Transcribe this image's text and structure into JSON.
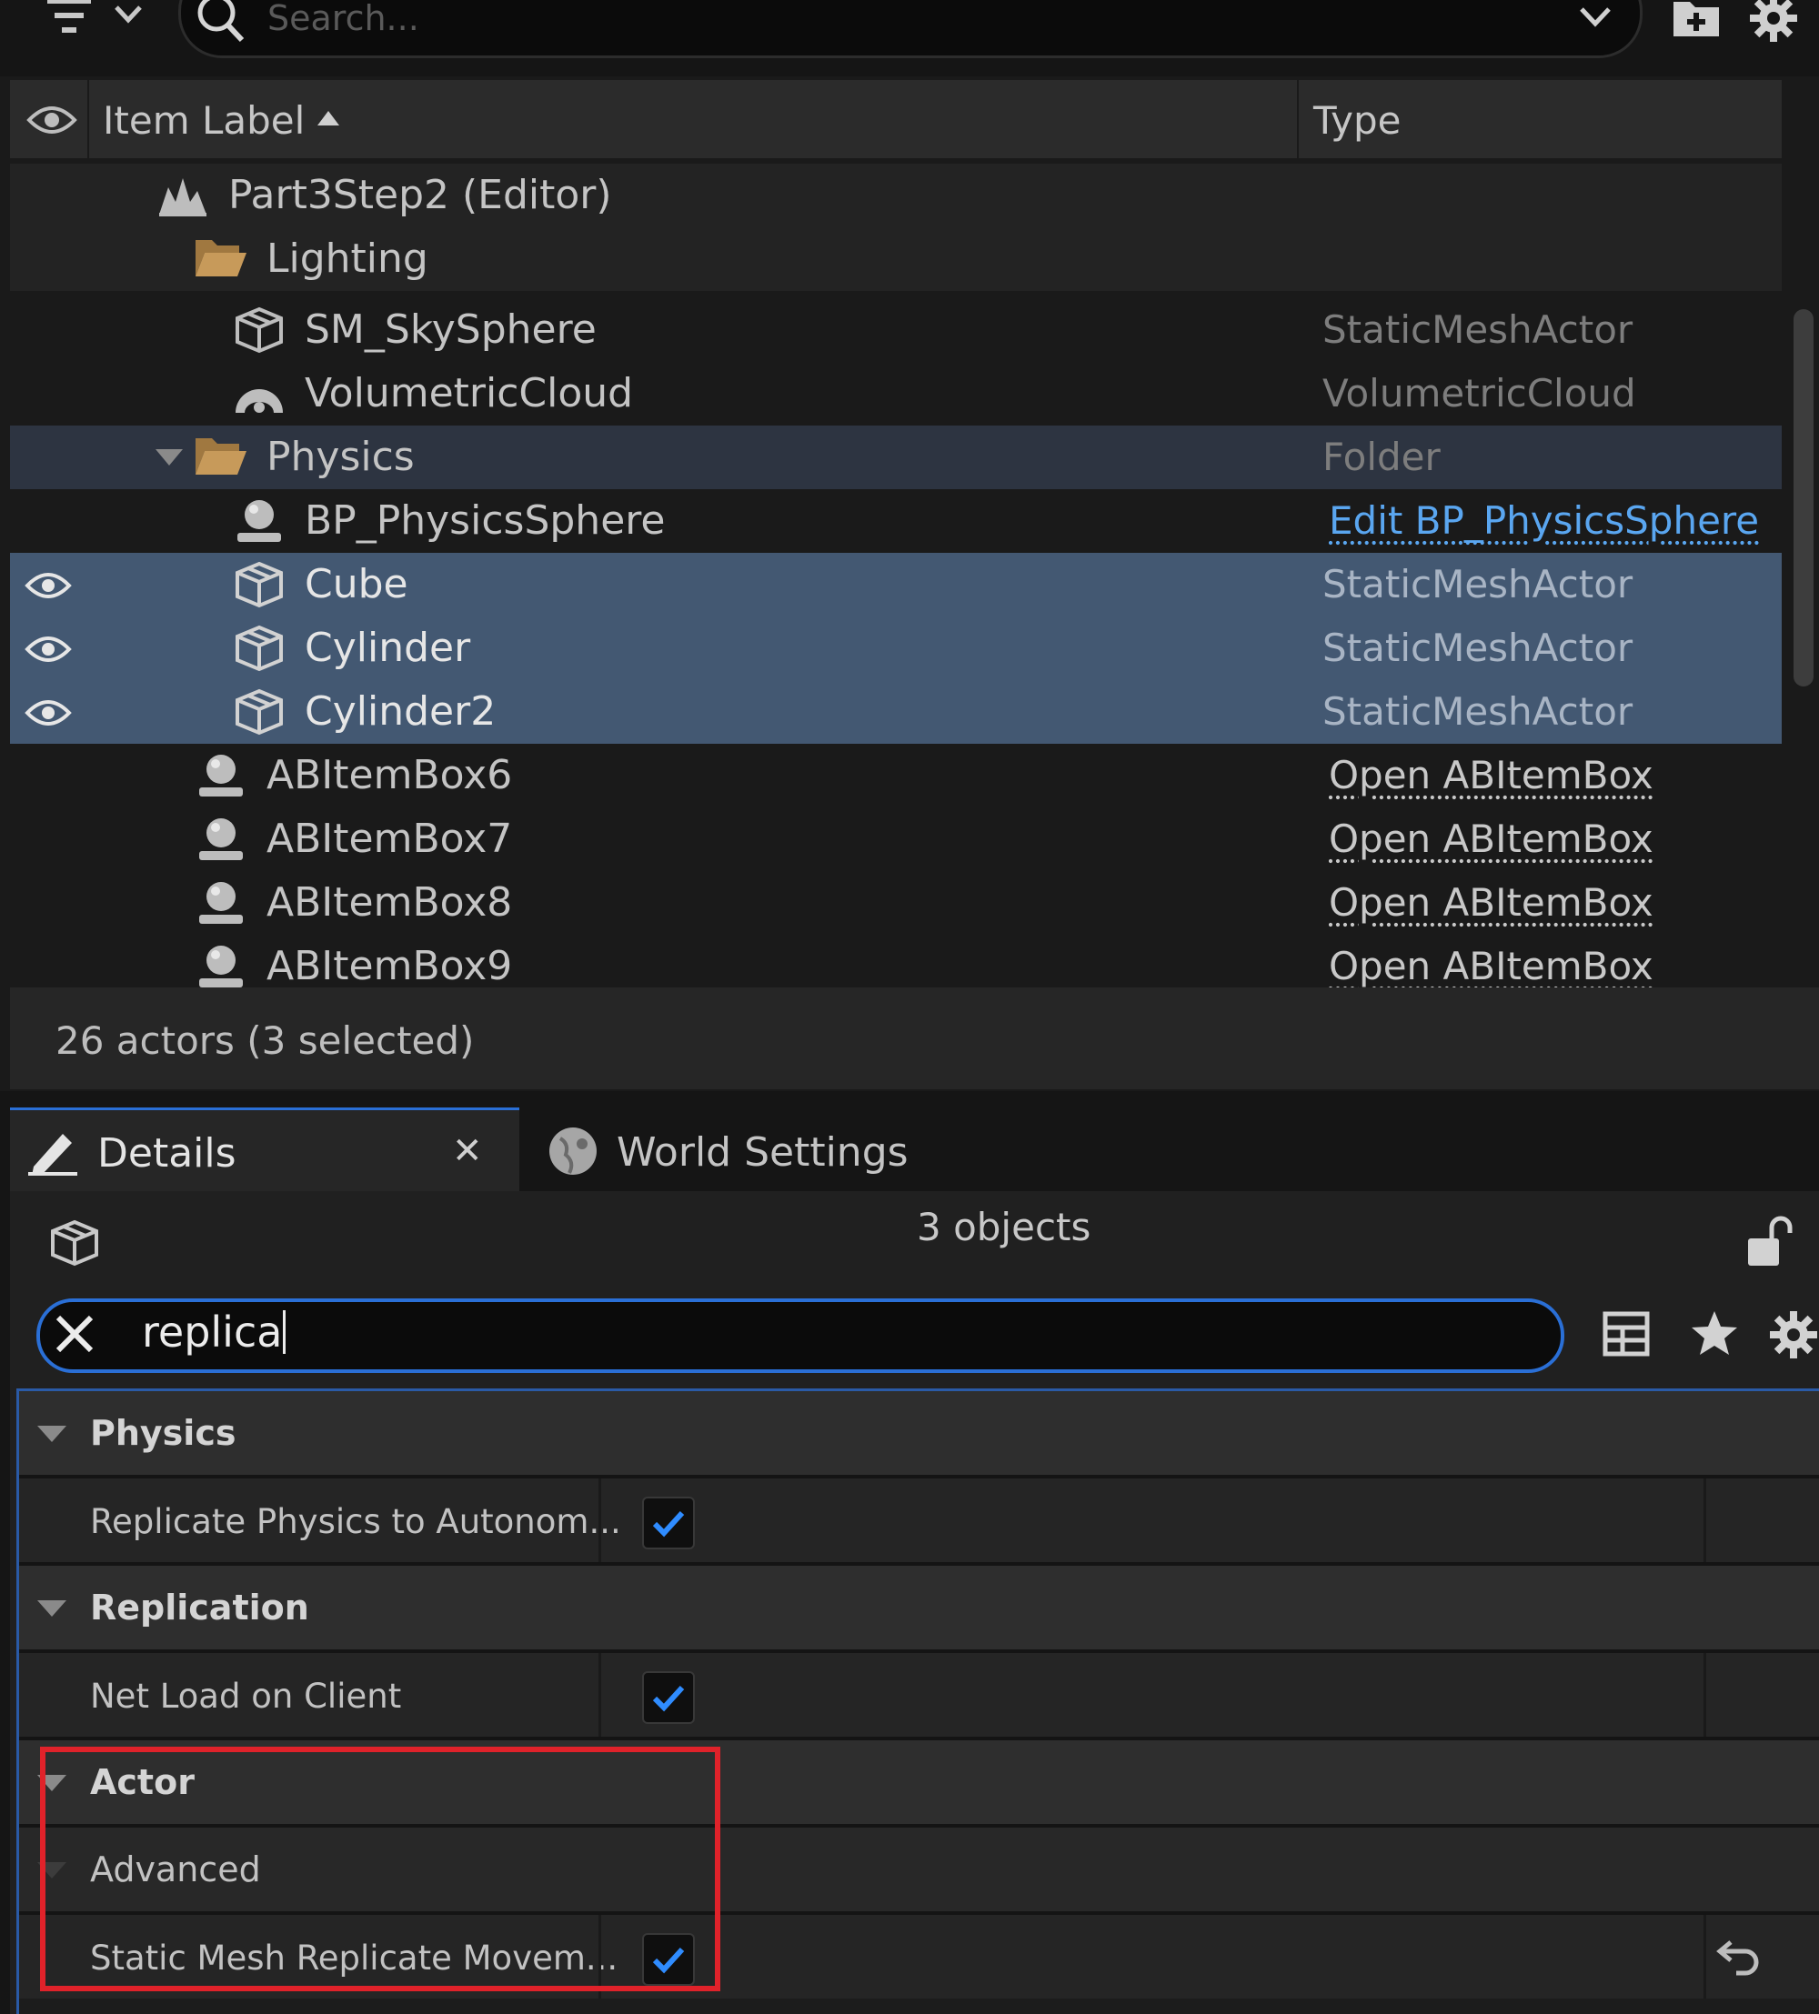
{
  "outliner": {
    "search_placeholder": "Search...",
    "columns": {
      "label": "Item Label",
      "type": "Type"
    },
    "rows": [
      {
        "label": "Part3Step2 (Editor)",
        "type": "",
        "icon": "level-icon"
      },
      {
        "label": "Lighting",
        "type": "",
        "icon": "folder-icon"
      },
      {
        "label": "SM_SkySphere",
        "type": "StaticMeshActor",
        "icon": "static-mesh-icon"
      },
      {
        "label": "VolumetricCloud",
        "type": "VolumetricCloud",
        "icon": "cloud-icon"
      },
      {
        "label": "Physics",
        "type": "Folder",
        "icon": "folder-icon"
      },
      {
        "label": "BP_PhysicsSphere",
        "type": "Edit BP_PhysicsSphere",
        "icon": "actor-icon"
      },
      {
        "label": "Cube",
        "type": "StaticMeshActor",
        "icon": "static-mesh-icon",
        "selected": true
      },
      {
        "label": "Cylinder",
        "type": "StaticMeshActor",
        "icon": "static-mesh-icon",
        "selected": true
      },
      {
        "label": "Cylinder2",
        "type": "StaticMeshActor",
        "icon": "static-mesh-icon",
        "selected": true
      },
      {
        "label": "ABItemBox6",
        "type": "Open ABItemBox",
        "icon": "actor-icon"
      },
      {
        "label": "ABItemBox7",
        "type": "Open ABItemBox",
        "icon": "actor-icon"
      },
      {
        "label": "ABItemBox8",
        "type": "Open ABItemBox",
        "icon": "actor-icon"
      },
      {
        "label": "ABItemBox9",
        "type": "Open ABItemBox",
        "icon": "actor-icon"
      }
    ],
    "footer": "26 actors (3 selected)"
  },
  "details": {
    "tabs": {
      "details": "Details",
      "world_settings": "World Settings"
    },
    "object_count": "3 objects",
    "filter_value": "replica",
    "categories": {
      "physics": "Physics",
      "replication": "Replication",
      "actor": "Actor",
      "advanced": "Advanced"
    },
    "properties": {
      "replicate_physics": {
        "label": "Replicate Physics to Autonom...",
        "checked": true
      },
      "net_load": {
        "label": "Net Load on Client",
        "checked": true
      },
      "static_mesh_replicate": {
        "label": "Static Mesh Replicate Movem...",
        "checked": true
      }
    }
  },
  "colors": {
    "selection": "#435872",
    "accent": "#2a6fd6",
    "check": "#2f8cff",
    "highlight_box": "#e0222a",
    "folder": "#c79a5a"
  }
}
